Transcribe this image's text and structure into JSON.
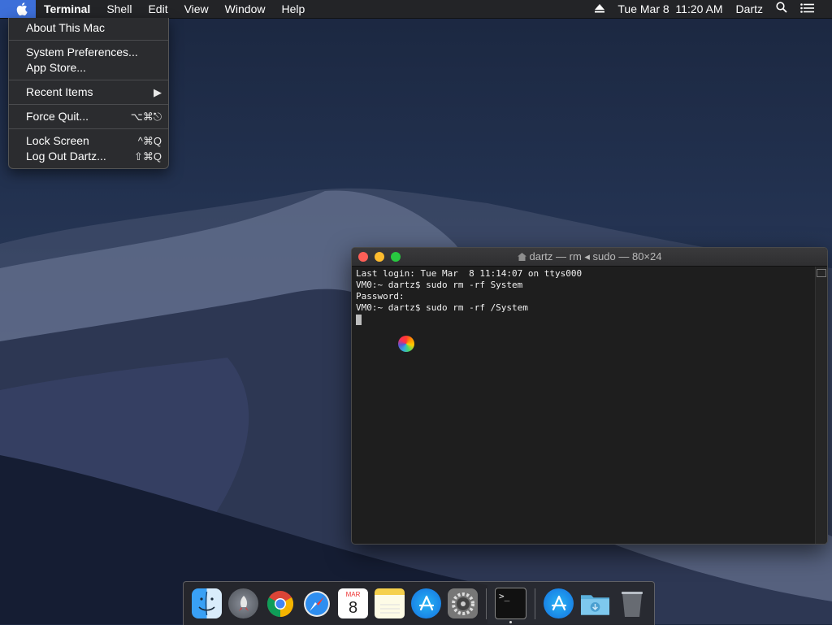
{
  "menubar": {
    "app_name": "Terminal",
    "menus": [
      "Shell",
      "Edit",
      "View",
      "Window",
      "Help"
    ],
    "datetime": "Tue Mar 8  11:20 AM",
    "user": "Dartz"
  },
  "apple_menu": {
    "items": [
      {
        "label": "About This Mac",
        "shortcut": ""
      },
      {
        "label": "System Preferences...",
        "shortcut": ""
      },
      {
        "label": "App Store...",
        "shortcut": ""
      },
      {
        "label": "Recent Items",
        "shortcut": "▶"
      },
      {
        "label": "Force Quit...",
        "shortcut": "⌥⌘⎋"
      },
      {
        "label": "Lock Screen",
        "shortcut": "^⌘Q"
      },
      {
        "label": "Log Out Dartz...",
        "shortcut": "⇧⌘Q"
      }
    ]
  },
  "terminal": {
    "title": "dartz — rm ◂ sudo — 80×24",
    "lines": [
      "Last login: Tue Mar  8 11:14:07 on ttys000",
      "VM0:~ dartz$ sudo rm -rf System",
      "Password:",
      "VM0:~ dartz$ sudo rm -rf /System"
    ]
  },
  "dock": {
    "apps": [
      "finder-icon",
      "launchpad-icon",
      "chrome-icon",
      "safari-icon",
      "calendar-icon",
      "notes-icon",
      "app-store-icon",
      "system-preferences-icon",
      "terminal-icon",
      "app-store-folder-icon",
      "downloads-folder-icon",
      "trash-icon"
    ],
    "calendar_month": "MAR",
    "calendar_day": "8"
  },
  "colors": {
    "menu_highlight": "#3d6fd9",
    "traffic_red": "#fe5f57",
    "traffic_yellow": "#febc2e",
    "traffic_green": "#28c840"
  }
}
